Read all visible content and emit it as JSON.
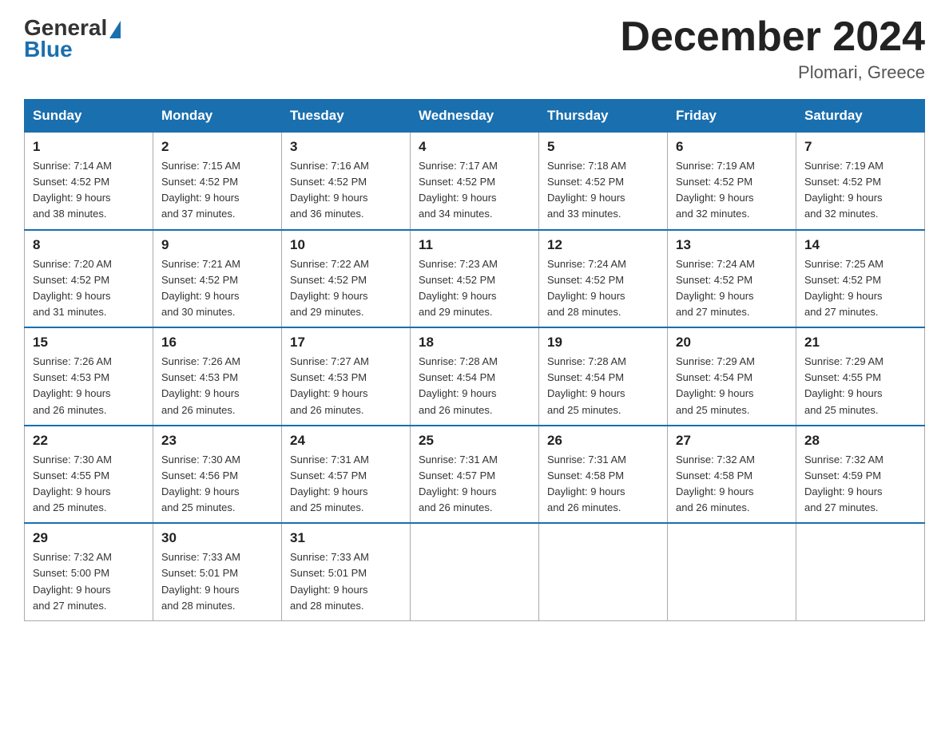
{
  "header": {
    "logo_general": "General",
    "logo_blue": "Blue",
    "month_title": "December 2024",
    "location": "Plomari, Greece"
  },
  "weekdays": [
    "Sunday",
    "Monday",
    "Tuesday",
    "Wednesday",
    "Thursday",
    "Friday",
    "Saturday"
  ],
  "weeks": [
    [
      {
        "day": "1",
        "sunrise": "7:14 AM",
        "sunset": "4:52 PM",
        "daylight": "9 hours and 38 minutes."
      },
      {
        "day": "2",
        "sunrise": "7:15 AM",
        "sunset": "4:52 PM",
        "daylight": "9 hours and 37 minutes."
      },
      {
        "day": "3",
        "sunrise": "7:16 AM",
        "sunset": "4:52 PM",
        "daylight": "9 hours and 36 minutes."
      },
      {
        "day": "4",
        "sunrise": "7:17 AM",
        "sunset": "4:52 PM",
        "daylight": "9 hours and 34 minutes."
      },
      {
        "day": "5",
        "sunrise": "7:18 AM",
        "sunset": "4:52 PM",
        "daylight": "9 hours and 33 minutes."
      },
      {
        "day": "6",
        "sunrise": "7:19 AM",
        "sunset": "4:52 PM",
        "daylight": "9 hours and 32 minutes."
      },
      {
        "day": "7",
        "sunrise": "7:19 AM",
        "sunset": "4:52 PM",
        "daylight": "9 hours and 32 minutes."
      }
    ],
    [
      {
        "day": "8",
        "sunrise": "7:20 AM",
        "sunset": "4:52 PM",
        "daylight": "9 hours and 31 minutes."
      },
      {
        "day": "9",
        "sunrise": "7:21 AM",
        "sunset": "4:52 PM",
        "daylight": "9 hours and 30 minutes."
      },
      {
        "day": "10",
        "sunrise": "7:22 AM",
        "sunset": "4:52 PM",
        "daylight": "9 hours and 29 minutes."
      },
      {
        "day": "11",
        "sunrise": "7:23 AM",
        "sunset": "4:52 PM",
        "daylight": "9 hours and 29 minutes."
      },
      {
        "day": "12",
        "sunrise": "7:24 AM",
        "sunset": "4:52 PM",
        "daylight": "9 hours and 28 minutes."
      },
      {
        "day": "13",
        "sunrise": "7:24 AM",
        "sunset": "4:52 PM",
        "daylight": "9 hours and 27 minutes."
      },
      {
        "day": "14",
        "sunrise": "7:25 AM",
        "sunset": "4:52 PM",
        "daylight": "9 hours and 27 minutes."
      }
    ],
    [
      {
        "day": "15",
        "sunrise": "7:26 AM",
        "sunset": "4:53 PM",
        "daylight": "9 hours and 26 minutes."
      },
      {
        "day": "16",
        "sunrise": "7:26 AM",
        "sunset": "4:53 PM",
        "daylight": "9 hours and 26 minutes."
      },
      {
        "day": "17",
        "sunrise": "7:27 AM",
        "sunset": "4:53 PM",
        "daylight": "9 hours and 26 minutes."
      },
      {
        "day": "18",
        "sunrise": "7:28 AM",
        "sunset": "4:54 PM",
        "daylight": "9 hours and 26 minutes."
      },
      {
        "day": "19",
        "sunrise": "7:28 AM",
        "sunset": "4:54 PM",
        "daylight": "9 hours and 25 minutes."
      },
      {
        "day": "20",
        "sunrise": "7:29 AM",
        "sunset": "4:54 PM",
        "daylight": "9 hours and 25 minutes."
      },
      {
        "day": "21",
        "sunrise": "7:29 AM",
        "sunset": "4:55 PM",
        "daylight": "9 hours and 25 minutes."
      }
    ],
    [
      {
        "day": "22",
        "sunrise": "7:30 AM",
        "sunset": "4:55 PM",
        "daylight": "9 hours and 25 minutes."
      },
      {
        "day": "23",
        "sunrise": "7:30 AM",
        "sunset": "4:56 PM",
        "daylight": "9 hours and 25 minutes."
      },
      {
        "day": "24",
        "sunrise": "7:31 AM",
        "sunset": "4:57 PM",
        "daylight": "9 hours and 25 minutes."
      },
      {
        "day": "25",
        "sunrise": "7:31 AM",
        "sunset": "4:57 PM",
        "daylight": "9 hours and 26 minutes."
      },
      {
        "day": "26",
        "sunrise": "7:31 AM",
        "sunset": "4:58 PM",
        "daylight": "9 hours and 26 minutes."
      },
      {
        "day": "27",
        "sunrise": "7:32 AM",
        "sunset": "4:58 PM",
        "daylight": "9 hours and 26 minutes."
      },
      {
        "day": "28",
        "sunrise": "7:32 AM",
        "sunset": "4:59 PM",
        "daylight": "9 hours and 27 minutes."
      }
    ],
    [
      {
        "day": "29",
        "sunrise": "7:32 AM",
        "sunset": "5:00 PM",
        "daylight": "9 hours and 27 minutes."
      },
      {
        "day": "30",
        "sunrise": "7:33 AM",
        "sunset": "5:01 PM",
        "daylight": "9 hours and 28 minutes."
      },
      {
        "day": "31",
        "sunrise": "7:33 AM",
        "sunset": "5:01 PM",
        "daylight": "9 hours and 28 minutes."
      },
      null,
      null,
      null,
      null
    ]
  ]
}
